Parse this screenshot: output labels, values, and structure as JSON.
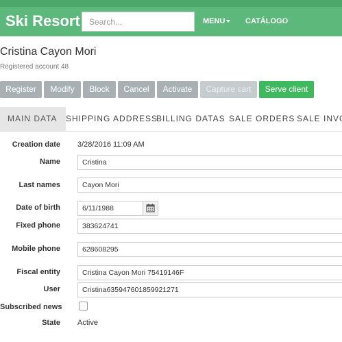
{
  "header": {
    "brand": "Ski Resort",
    "search_placeholder": "Search...",
    "menu_label": "MENU",
    "catalog_label": "CATÁLOGO"
  },
  "customer": {
    "name": "Cristina Cayon Mori",
    "subtitle": "Registered account 48"
  },
  "actions": {
    "register": "Register",
    "modify": "Modify",
    "block": "Block",
    "cancel": "Cancel",
    "activate": "Activate",
    "capture_cart": "Capture cart",
    "serve_client": "Serve client"
  },
  "tabs": [
    {
      "label": "MAIN DATA",
      "active": true
    },
    {
      "label": "SHIPPING ADDRESS",
      "active": false
    },
    {
      "label": "BILLING DATAS",
      "active": false
    },
    {
      "label": "SALE ORDERS",
      "active": false
    },
    {
      "label": "SALE INVOIC",
      "active": false
    }
  ],
  "form": {
    "creation_date": {
      "label": "Creation date",
      "value": "3/28/2016 11:09 AM"
    },
    "name": {
      "label": "Name",
      "value": "Cristina"
    },
    "last_names": {
      "label": "Last names",
      "value": "Cayon Mori"
    },
    "date_of_birth": {
      "label": "Date of birth",
      "value": "6/11/1988"
    },
    "fixed_phone": {
      "label": "Fixed phone",
      "value": "383624741"
    },
    "mobile_phone": {
      "label": "Mobile phone",
      "value": "628608295"
    },
    "fiscal_entity": {
      "label": "Fiscal entity",
      "value": "Cristina Cayon Mori 75419146F"
    },
    "user": {
      "label": "User",
      "value": "Cristina635947601859921271"
    },
    "subscribed_news": {
      "label": "Subscribed news",
      "checked": false
    },
    "state": {
      "label": "State",
      "value": "Active"
    }
  },
  "colors": {
    "navbar": "#5cb97b",
    "button_gray": "#a9b0b4",
    "button_green": "#3fb860"
  }
}
